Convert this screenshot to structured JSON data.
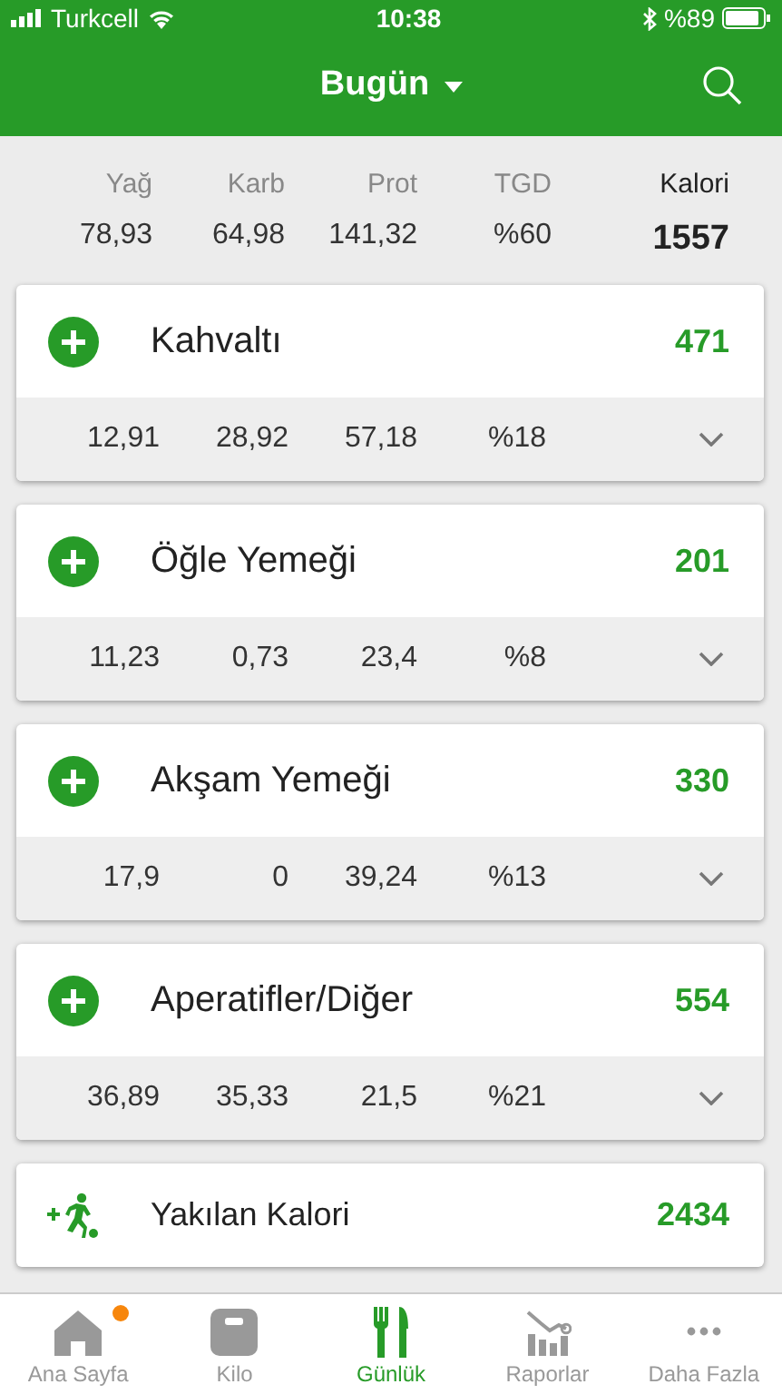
{
  "status_bar": {
    "carrier": "Turkcell",
    "time": "10:38",
    "battery": "%89"
  },
  "header": {
    "title": "Bugün"
  },
  "summary": {
    "columns": [
      {
        "label": "Yağ",
        "value": "78,93",
        "kind": "macro"
      },
      {
        "label": "Karb",
        "value": "64,98",
        "kind": "macro"
      },
      {
        "label": "Prot",
        "value": "141,32",
        "kind": "macro"
      },
      {
        "label": "TGD",
        "value": "%60",
        "kind": "macro"
      },
      {
        "label": "Kalori",
        "value": "1557",
        "kind": "total"
      }
    ]
  },
  "meals": [
    {
      "name": "Kahvaltı",
      "calories": "471",
      "macros": [
        "12,91",
        "28,92",
        "57,18",
        "%18"
      ],
      "expanded": false
    },
    {
      "name": "Öğle Yemeği",
      "calories": "201",
      "macros": [
        "11,23",
        "0,73",
        "23,4",
        "%8"
      ],
      "expanded": false
    },
    {
      "name": "Akşam Yemeği",
      "calories": "330",
      "macros": [
        "17,9",
        "0",
        "39,24",
        "%13"
      ],
      "expanded": false
    },
    {
      "name": "Aperatifler/Diğer",
      "calories": "554",
      "macros": [
        "36,89",
        "35,33",
        "21,5",
        "%21"
      ],
      "expanded": false
    }
  ],
  "burned": {
    "label": "Yakılan Kalori",
    "calories": "2434"
  },
  "tab_bar": [
    {
      "label": "Ana Sayfa",
      "kind": "home",
      "selected": false,
      "notification": true
    },
    {
      "label": "Kilo",
      "kind": "scale",
      "selected": false,
      "notification": false
    },
    {
      "label": "Günlük",
      "kind": "diary",
      "selected": true,
      "notification": false
    },
    {
      "label": "Raporlar",
      "kind": "reports",
      "selected": false,
      "notification": false
    },
    {
      "label": "Daha Fazla",
      "kind": "more",
      "selected": false,
      "notification": false
    }
  ]
}
